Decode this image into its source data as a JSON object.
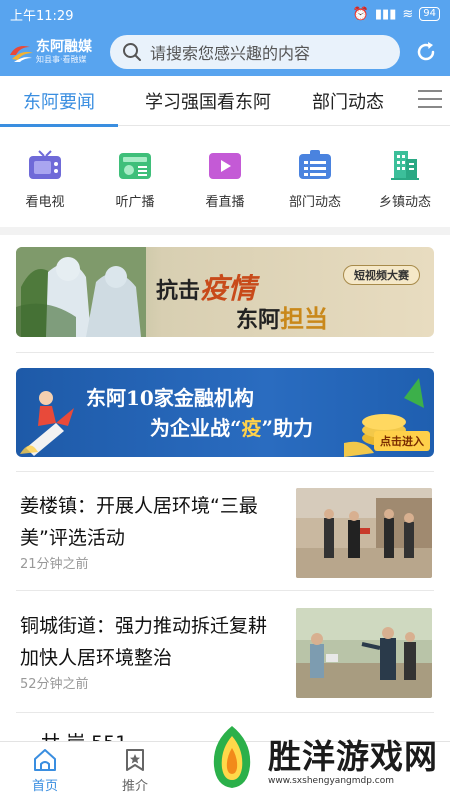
{
  "status": {
    "time": "上午11:29",
    "battery": "94"
  },
  "header": {
    "logo_name": "东阿融媒",
    "logo_slogan": "知县事·看融媒",
    "search_placeholder": "请搜索您感兴趣的内容"
  },
  "tabs": [
    {
      "label": "东阿要闻",
      "active": true
    },
    {
      "label": "学习强国看东阿",
      "active": false
    },
    {
      "label": "部门动态",
      "active": false
    }
  ],
  "shortcuts": [
    {
      "label": "看电视",
      "icon": "tv-icon",
      "color": "#6f6ad8"
    },
    {
      "label": "听广播",
      "icon": "radio-icon",
      "color": "#3fbf7a"
    },
    {
      "label": "看直播",
      "icon": "live-video-icon",
      "color": "#c45ad6"
    },
    {
      "label": "部门动态",
      "icon": "department-icon",
      "color": "#4a83df"
    },
    {
      "label": "乡镇动态",
      "icon": "town-buildings-icon",
      "color": "#3cbf9a"
    }
  ],
  "banners": {
    "banner1": {
      "line1_a": "抗击",
      "line1_b": "疫情",
      "line2_a": "东阿",
      "line2_b": "担当",
      "badge": "短视频大赛"
    },
    "banner2": {
      "line1": "东阿10家金融机构",
      "line2_a": "为企业战“",
      "line2_b": "疫",
      "line2_c": "”助力",
      "cta": "点击进入"
    }
  },
  "news": [
    {
      "title": "姜楼镇：开展人居环境“三最美”评选活动",
      "time": "21分钟之前"
    },
    {
      "title": "铜城街道：强力推动拆迁复耕 加快人居环境整治",
      "time": "52分钟之前"
    }
  ],
  "partial_news": "一 廿 岸 551 ...",
  "bottom_nav": [
    {
      "label": "首页",
      "icon": "home-icon",
      "active": true
    },
    {
      "label": "推介",
      "icon": "bookmark-star-icon",
      "active": false
    }
  ],
  "watermark": {
    "title": "胜洋游戏网",
    "url": "www.sxshengyangmdp.com"
  },
  "colors": {
    "primary": "#58a4ef",
    "accent": "#3a8ee0"
  }
}
